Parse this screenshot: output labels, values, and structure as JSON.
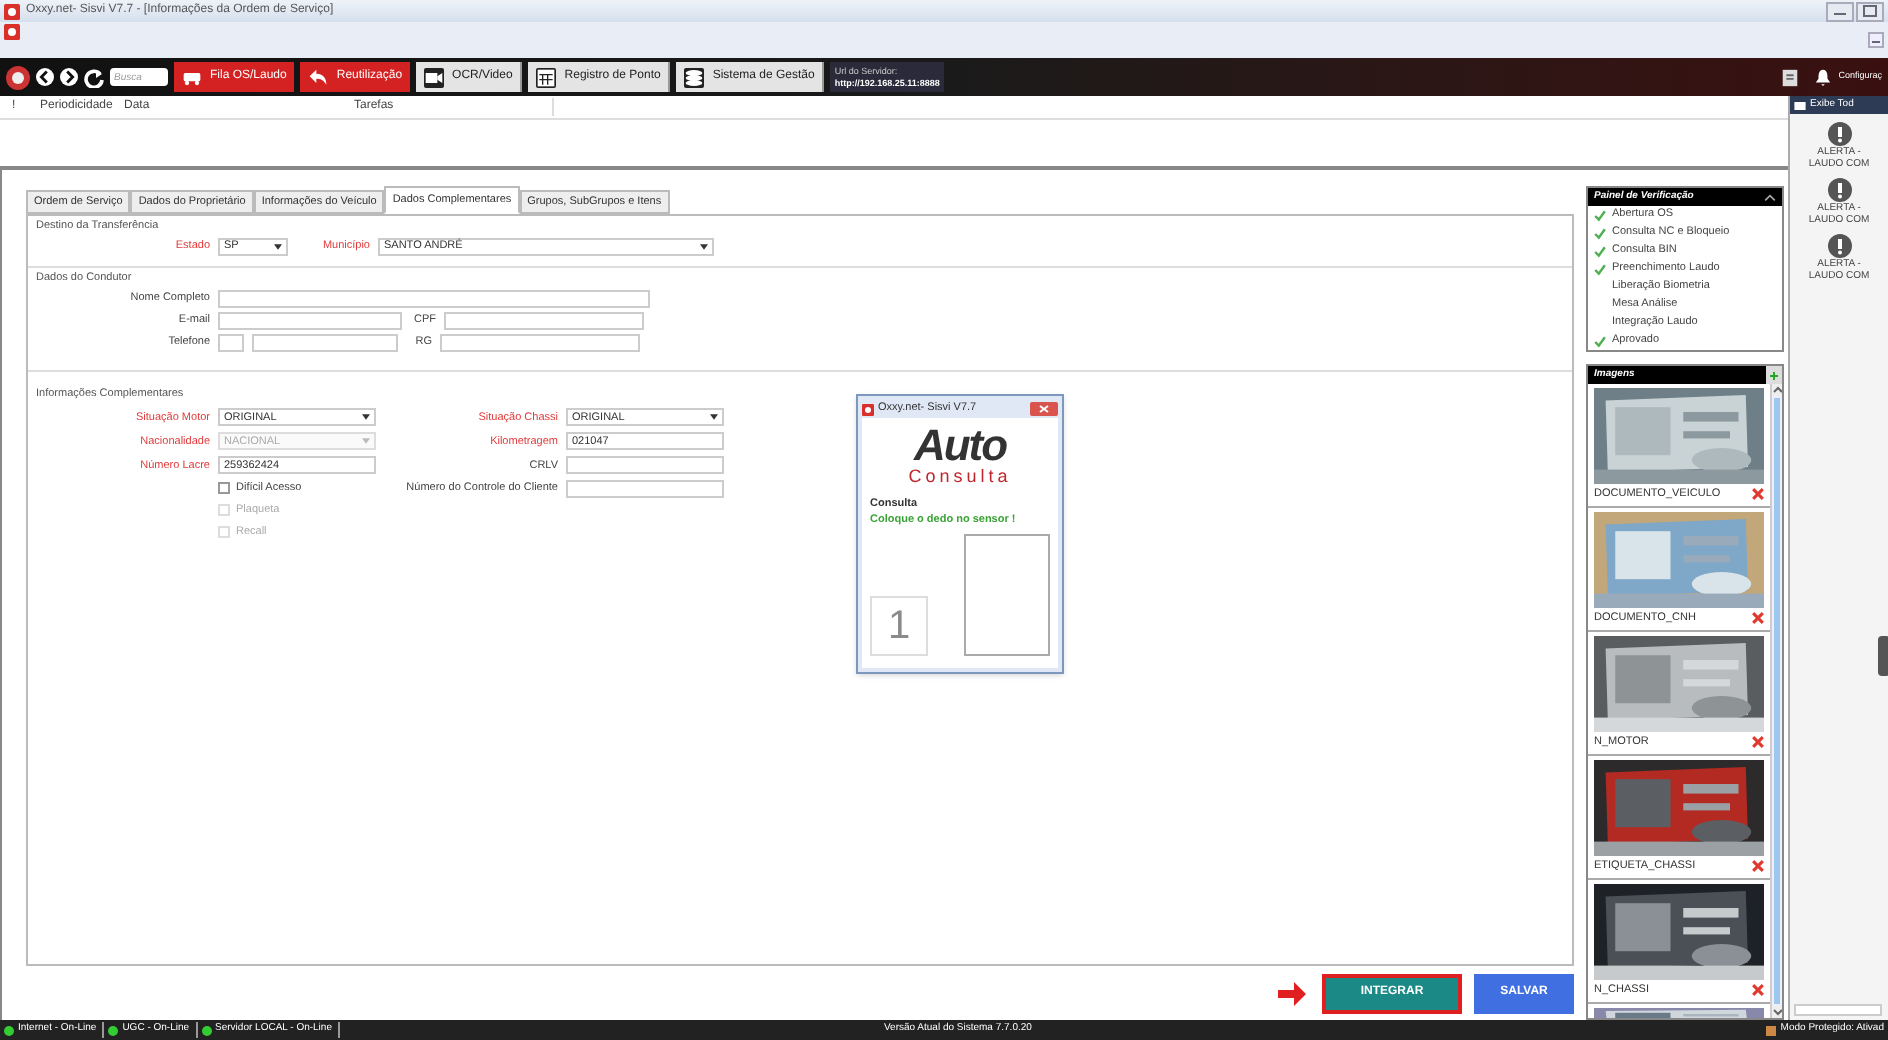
{
  "window": {
    "title": "Oxxy.net- Sisvi V7.7 - [Informações da Ordem de Serviço]"
  },
  "toolbar": {
    "search_placeholder": "Busca",
    "buttons": [
      {
        "label": "Fila OS/Laudo",
        "kind": "red"
      },
      {
        "label": "Reutilização",
        "kind": "red"
      },
      {
        "label": "OCR/Video",
        "kind": "dark"
      },
      {
        "label": "Registro de Ponto",
        "kind": "dark"
      },
      {
        "label": "Sistema de Gestão",
        "kind": "dark"
      }
    ],
    "server_label": "Url do Servidor:",
    "server_url": "http://192.168.25.11:8888",
    "settings": "Configuraç"
  },
  "task_table": {
    "columns": [
      "!",
      "Periodicidade",
      "Data",
      "Tarefas"
    ]
  },
  "tabs": [
    {
      "label": "Ordem de Serviço",
      "selected": false
    },
    {
      "label": "Dados do Proprietário",
      "selected": false
    },
    {
      "label": "Informações do Veículo",
      "selected": false
    },
    {
      "label": "Dados Complementares",
      "selected": true
    },
    {
      "label": "Grupos, SubGrupos e Itens",
      "selected": false
    }
  ],
  "destino": {
    "title": "Destino da Transferência",
    "fields": [
      {
        "label": "Estado",
        "value": "SP",
        "required": true
      },
      {
        "label": "Município",
        "value": "SANTO ANDRÉ",
        "required": true
      }
    ]
  },
  "condutor": {
    "title": "Dados do Condutor",
    "fields": [
      {
        "label": "Nome Completo",
        "required": false
      },
      {
        "label": "E-mail",
        "required": false
      },
      {
        "label": "CPF",
        "required": false
      },
      {
        "label": "Telefone",
        "required": false
      },
      {
        "label": "RG",
        "required": false
      }
    ]
  },
  "complementares": {
    "title": "Informações Complementares",
    "fields": [
      {
        "label": "Situação Motor",
        "value": "ORIGINAL",
        "kind": "select",
        "required": true,
        "disabled": false
      },
      {
        "label": "Situação Chassi",
        "value": "ORIGINAL",
        "kind": "select",
        "required": true,
        "disabled": false
      },
      {
        "label": "Nacionalidade",
        "value": "NACIONAL",
        "kind": "select",
        "required": true,
        "disabled": true
      },
      {
        "label": "Kilometragem",
        "value": "021047",
        "kind": "text",
        "required": true,
        "disabled": false
      },
      {
        "label": "Número Lacre",
        "value": "259362424",
        "kind": "text",
        "required": true,
        "disabled": false
      },
      {
        "label": "CRLV",
        "kind": "text",
        "required": false,
        "disabled": false
      },
      {
        "label": "Número do Controle do Cliente",
        "kind": "text",
        "required": false,
        "disabled": false
      }
    ],
    "checkboxes": [
      {
        "label": "Difícil Acesso",
        "checked": false,
        "disabled": false
      },
      {
        "label": "Plaqueta",
        "checked": false,
        "disabled": true
      },
      {
        "label": "Recall",
        "checked": false,
        "disabled": true
      }
    ]
  },
  "popup": {
    "title": "Oxxy.net- Sisvi V7.7",
    "logo_top": "Auto",
    "logo_bottom": "Consulta",
    "heading": "Consulta",
    "message": "Coloque o dedo no sensor !",
    "finger": "1"
  },
  "verification": {
    "title": "Painel de Verificação",
    "items": [
      {
        "label": "Abertura OS",
        "done": true
      },
      {
        "label": "Consulta NC e Bloqueio",
        "done": true
      },
      {
        "label": "Consulta BIN",
        "done": true
      },
      {
        "label": "Preenchimento Laudo",
        "done": true
      },
      {
        "label": "Liberação Biometria",
        "done": false
      },
      {
        "label": "Mesa Análise",
        "done": false
      },
      {
        "label": "Integração Laudo",
        "done": false
      },
      {
        "label": "Aprovado",
        "done": true
      }
    ]
  },
  "images": {
    "title": "Imagens",
    "items": [
      {
        "label": "DOCUMENTO_VEICULO"
      },
      {
        "label": "DOCUMENTO_CNH"
      },
      {
        "label": "N_MOTOR"
      },
      {
        "label": "ETIQUETA_CHASSI"
      },
      {
        "label": "N_CHASSI"
      },
      {
        "kind": "picture"
      }
    ]
  },
  "actions": [
    {
      "label": "INTEGRAR",
      "highlighted": true,
      "color": "#1b8a87"
    },
    {
      "label": "SALVAR",
      "highlighted": false,
      "color": "#3f6fe0"
    }
  ],
  "alerts": {
    "show_all": "Exibe Tod",
    "items": [
      "ALERTA -\nLAUDO COM",
      "ALERTA -\nLAUDO COM",
      "ALERTA -\nLAUDO COM"
    ]
  },
  "status_bar": {
    "items": [
      "Internet - On-Line",
      "UGC - On-Line",
      "Servidor LOCAL - On-Line"
    ],
    "version": "Versão Atual do Sistema 7.7.0.20",
    "mode": "Modo Protegido: Ativad"
  }
}
